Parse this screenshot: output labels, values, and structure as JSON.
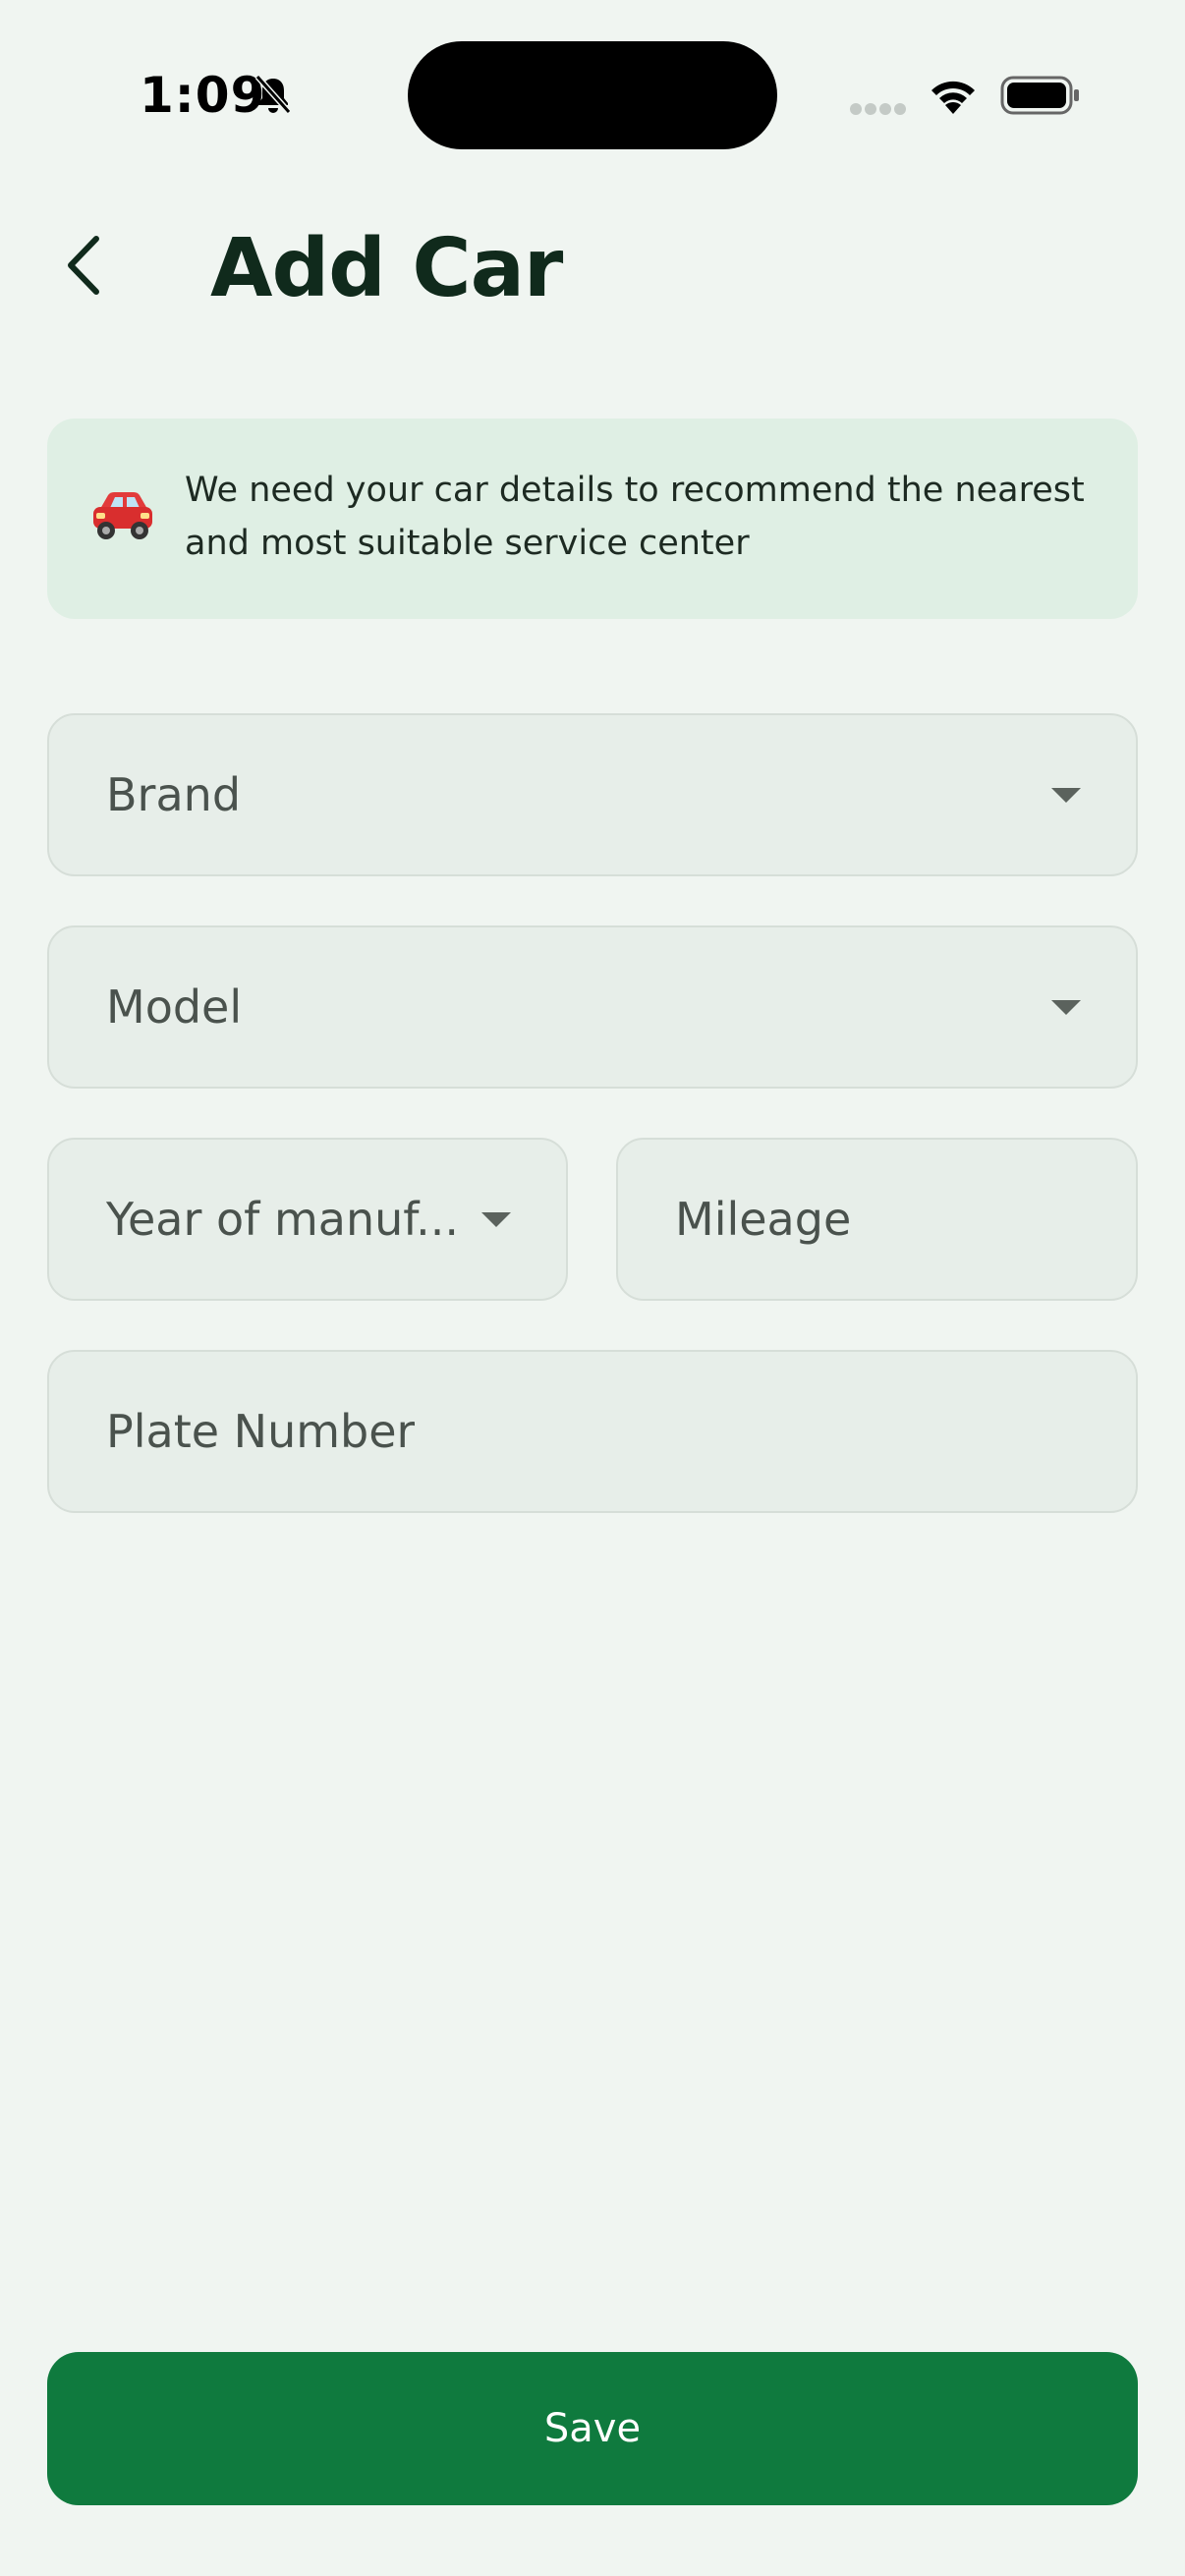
{
  "status_bar": {
    "time": "1:09",
    "icons": [
      "bell-muted-icon",
      "signal-icon",
      "wifi-icon",
      "battery-icon"
    ]
  },
  "header": {
    "back_icon": "chevron-left-icon",
    "title": "Add Car"
  },
  "info_banner": {
    "icon": "car-icon",
    "text": "We need your car details to recommend the nearest and most suitable service center"
  },
  "form": {
    "brand": {
      "placeholder": "Brand",
      "type": "dropdown"
    },
    "model": {
      "placeholder": "Model",
      "type": "dropdown"
    },
    "year": {
      "placeholder": "Year of manuf...",
      "type": "dropdown"
    },
    "mileage": {
      "placeholder": "Mileage",
      "type": "text"
    },
    "plate": {
      "placeholder": "Plate Number",
      "type": "text"
    }
  },
  "actions": {
    "save_label": "Save"
  },
  "colors": {
    "background": "#f0f5f1",
    "banner": "#dfefe4",
    "field": "#e7eee9",
    "primary": "#0f7a3e",
    "title": "#102a1c"
  }
}
